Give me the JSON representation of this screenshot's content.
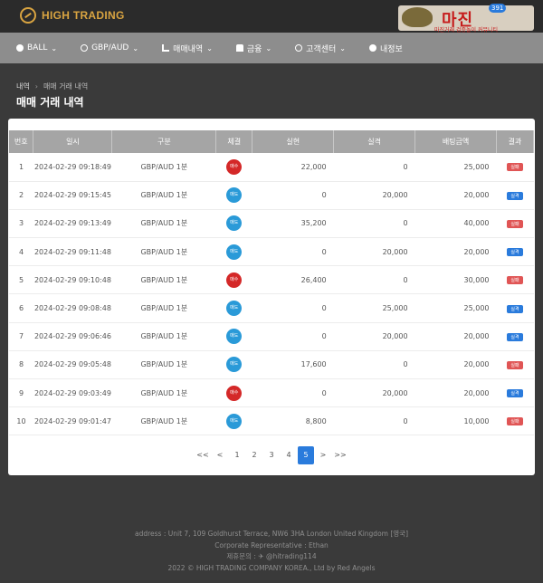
{
  "brand": {
    "name": "HIGH TRADING"
  },
  "badge": {
    "main": "마진",
    "count": "391",
    "sub": "마진거래 검증놀이 커뮤니티"
  },
  "nav": [
    {
      "label": "BALL",
      "icon": "ball-icon",
      "chevron": "⌄"
    },
    {
      "label": "GBP/AUD",
      "icon": "coin-icon",
      "chevron": "⌄"
    },
    {
      "label": "매매내역",
      "icon": "chart-icon",
      "chevron": "⌄"
    },
    {
      "label": "금융",
      "icon": "bank-icon",
      "chevron": "⌄"
    },
    {
      "label": "고객센터",
      "icon": "support-icon",
      "chevron": "⌄"
    },
    {
      "label": "내정보",
      "icon": "user-icon",
      "chevron": ""
    }
  ],
  "breadcrumb": {
    "root": "내역",
    "sep": "›",
    "current": "매매 거래 내역"
  },
  "page": {
    "title": "매매 거래 내역"
  },
  "table": {
    "headers": [
      "번호",
      "일시",
      "구분",
      "체결",
      "실현",
      "실격",
      "배팅금액",
      "결과"
    ],
    "rows": [
      {
        "no": "1",
        "date": "2024-02-29 09:18:49",
        "type": "GBP/AUD 1분",
        "exec": "매수",
        "realized": "22,000",
        "lost": "0",
        "bet": "25,000",
        "result": "실패"
      },
      {
        "no": "2",
        "date": "2024-02-29 09:15:45",
        "type": "GBP/AUD 1분",
        "exec": "매도",
        "realized": "0",
        "lost": "20,000",
        "bet": "20,000",
        "result": "실격"
      },
      {
        "no": "3",
        "date": "2024-02-29 09:13:49",
        "type": "GBP/AUD 1분",
        "exec": "매도",
        "realized": "35,200",
        "lost": "0",
        "bet": "40,000",
        "result": "실패"
      },
      {
        "no": "4",
        "date": "2024-02-29 09:11:48",
        "type": "GBP/AUD 1분",
        "exec": "매도",
        "realized": "0",
        "lost": "20,000",
        "bet": "20,000",
        "result": "실격"
      },
      {
        "no": "5",
        "date": "2024-02-29 09:10:48",
        "type": "GBP/AUD 1분",
        "exec": "매수",
        "realized": "26,400",
        "lost": "0",
        "bet": "30,000",
        "result": "실패"
      },
      {
        "no": "6",
        "date": "2024-02-29 09:08:48",
        "type": "GBP/AUD 1분",
        "exec": "매도",
        "realized": "0",
        "lost": "25,000",
        "bet": "25,000",
        "result": "실격"
      },
      {
        "no": "7",
        "date": "2024-02-29 09:06:46",
        "type": "GBP/AUD 1분",
        "exec": "매도",
        "realized": "0",
        "lost": "20,000",
        "bet": "20,000",
        "result": "실격"
      },
      {
        "no": "8",
        "date": "2024-02-29 09:05:48",
        "type": "GBP/AUD 1분",
        "exec": "매도",
        "realized": "17,600",
        "lost": "0",
        "bet": "20,000",
        "result": "실패"
      },
      {
        "no": "9",
        "date": "2024-02-29 09:03:49",
        "type": "GBP/AUD 1분",
        "exec": "매수",
        "realized": "0",
        "lost": "20,000",
        "bet": "20,000",
        "result": "실격"
      },
      {
        "no": "10",
        "date": "2024-02-29 09:01:47",
        "type": "GBP/AUD 1분",
        "exec": "매도",
        "realized": "8,800",
        "lost": "0",
        "bet": "10,000",
        "result": "실패"
      }
    ]
  },
  "pagination": {
    "first": "<<",
    "prev": "<",
    "pages": [
      "1",
      "2",
      "3",
      "4",
      "5"
    ],
    "active": "5",
    "next": ">",
    "last": ">>"
  },
  "footer": {
    "address": "address : Unit 7, 109 Goldhurst Terrace, NW6 3HA London United Kingdom [영국]",
    "rep": "Corporate Representative : Ethan",
    "contact": "제휴문의 : ✈ @hitrading114",
    "copyright": "2022 © HIGH TRADING COMPANY KOREA., Ltd by Red Angels"
  },
  "colors": {
    "buy": "#d42828",
    "sell": "#2a9ad8",
    "accent": "#2a7bdc",
    "brand": "#d9a441"
  }
}
